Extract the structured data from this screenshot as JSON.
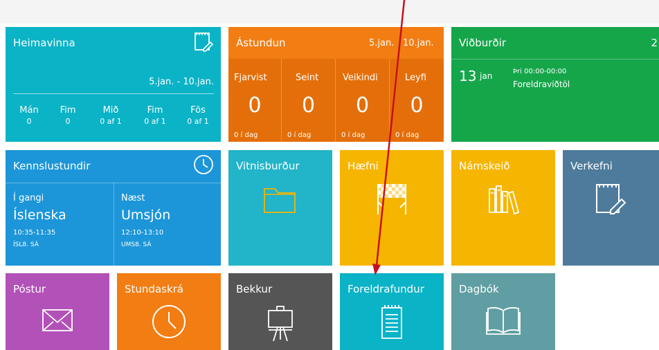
{
  "colors": {
    "cyan": "#0bb3c6",
    "orange": "#f27d12",
    "orange_dark": "#e46f0a",
    "green": "#15a64a",
    "blue": "#1c96d9",
    "teal": "#22b4c8",
    "yellow": "#f6b500",
    "steelblue": "#4e7b9c",
    "purple": "#b251b7",
    "darkgray": "#555555",
    "grayteal": "#5f9ea3",
    "arrow": "#c8101a"
  },
  "heimavinna": {
    "title": "Heimavinna",
    "range": "5.jan. - 10.jan.",
    "days": [
      {
        "label": "Mán",
        "value": "0"
      },
      {
        "label": "Fim",
        "value": "0"
      },
      {
        "label": "Mið",
        "value": "0 af 1"
      },
      {
        "label": "Fim",
        "value": "0 af 1"
      },
      {
        "label": "Fös",
        "value": "0 af 1"
      }
    ],
    "icon": "notepad-pencil-icon"
  },
  "astundun": {
    "title": "Ástundun",
    "start": "5.jan.",
    "end": "10.jan.",
    "cols": [
      {
        "label": "Fjarvist",
        "value": "0",
        "sub": "0 í dag"
      },
      {
        "label": "Seint",
        "value": "0",
        "sub": "0 í dag"
      },
      {
        "label": "Veikindi",
        "value": "0",
        "sub": "0 í dag"
      },
      {
        "label": "Leyfi",
        "value": "0",
        "sub": "0 í dag"
      }
    ]
  },
  "vidburdir": {
    "title": "Viðburðir",
    "count": "2",
    "day": "13",
    "month": "jan",
    "time": "Þri 00:00-00:00",
    "name": "Foreldraviðtöl"
  },
  "kennslustundir": {
    "title": "Kennslustundir",
    "current": {
      "label": "Í gangi",
      "subject": "Íslenska",
      "time": "10:35-11:35",
      "code": "ÍSL8. SÁ"
    },
    "next": {
      "label": "Næst",
      "subject": "Umsjón",
      "time": "12:10-13:10",
      "code": "UMS8. SÁ"
    },
    "icon": "clock-icon"
  },
  "tiles": {
    "vitnisburdur": "Vitnisburður",
    "haefni": "Hæfni",
    "namskeid": "Námskeið",
    "verkefni": "Verkefni",
    "postur": "Póstur",
    "stundaskra": "Stundaskrá",
    "bekkur": "Bekkur",
    "foreldrafundur": "Foreldrafundur",
    "dagbok": "Dagbók"
  }
}
